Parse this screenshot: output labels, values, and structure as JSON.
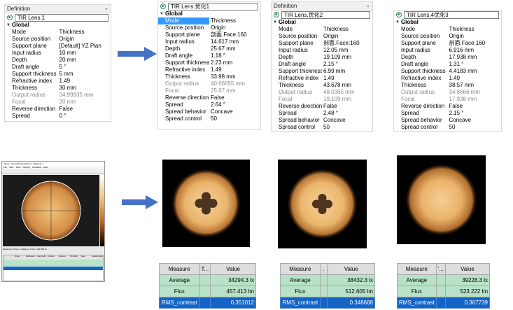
{
  "panels": [
    {
      "header": "Definition",
      "object": "TIR Lens.1",
      "section": "Global",
      "props": [
        {
          "k": "Mode",
          "v": "Thickness"
        },
        {
          "k": "Source position",
          "v": "Origin"
        },
        {
          "k": "Support plane",
          "v": "[Default] YZ Plan"
        },
        {
          "k": "Input radius",
          "v": "10 mm"
        },
        {
          "k": "Depth",
          "v": "20 mm"
        },
        {
          "k": "Draft angle",
          "v": "5 °"
        },
        {
          "k": "Support thickness",
          "v": "5 mm"
        },
        {
          "k": "Refractive index",
          "v": "1.49"
        },
        {
          "k": "Thickness",
          "v": "30 mm"
        },
        {
          "k": "Output radius",
          "v": "34.99935 mm",
          "grey": true
        },
        {
          "k": "Focal",
          "v": "20 mm",
          "grey": true
        },
        {
          "k": "Reverse direction",
          "v": "False"
        },
        {
          "k": "Spread",
          "v": "0 °"
        }
      ]
    },
    {
      "header": "",
      "object": "TIR Lens.优化1",
      "section": "Global",
      "props": [
        {
          "k": "Mode",
          "v": "Thickness",
          "sel": true
        },
        {
          "k": "Source position",
          "v": "Origin"
        },
        {
          "k": "Support plane",
          "v": "剖面.Face:160"
        },
        {
          "k": "Input radius",
          "v": "14.617 mm"
        },
        {
          "k": "Depth",
          "v": "25.67 mm"
        },
        {
          "k": "Draft angle",
          "v": "1.18 °"
        },
        {
          "k": "Support thickness",
          "v": "2.23 mm"
        },
        {
          "k": "Refractive index",
          "v": "1.49"
        },
        {
          "k": "Thickness",
          "v": "33.98 mm"
        },
        {
          "k": "Output radius",
          "v": "40.66655 mm",
          "grey": true
        },
        {
          "k": "Focal",
          "v": "25.67 mm",
          "grey": true
        },
        {
          "k": "Reverse direction",
          "v": "False"
        },
        {
          "k": "Spread",
          "v": "2.64 °"
        },
        {
          "k": "Spread behavior",
          "v": "Concave"
        },
        {
          "k": "Spread control",
          "v": "50"
        }
      ]
    },
    {
      "header": "Definition",
      "object": "TIR Lens.优化2",
      "section": "Global",
      "props": [
        {
          "k": "Mode",
          "v": "Thickness"
        },
        {
          "k": "Source position",
          "v": "Origin"
        },
        {
          "k": "Support plane",
          "v": "剖面.Face:160"
        },
        {
          "k": "Input radius",
          "v": "12.05 mm"
        },
        {
          "k": "Depth",
          "v": "19.109 mm"
        },
        {
          "k": "Draft angle",
          "v": "2.15 °"
        },
        {
          "k": "Support thickness",
          "v": "6.99 mm"
        },
        {
          "k": "Refractive index",
          "v": "1.49"
        },
        {
          "k": "Thickness",
          "v": "43.678 mm"
        },
        {
          "k": "Output radius",
          "v": "48.0365 mm",
          "grey": true
        },
        {
          "k": "Focal",
          "v": "19.109 mm",
          "grey": true
        },
        {
          "k": "Reverse direction",
          "v": "False"
        },
        {
          "k": "Spread",
          "v": "2.48 °"
        },
        {
          "k": "Spread behavior",
          "v": "Concave"
        },
        {
          "k": "Spread control",
          "v": "50"
        }
      ]
    },
    {
      "header": "",
      "object": "TIR Lens.4优化3",
      "section": "Global",
      "props": [
        {
          "k": "Mode",
          "v": "Thickness"
        },
        {
          "k": "Source position",
          "v": "Origin"
        },
        {
          "k": "Support plane",
          "v": "剖面.Face:160"
        },
        {
          "k": "Input radius",
          "v": "6.916 mm"
        },
        {
          "k": "Depth",
          "v": "17.938 mm"
        },
        {
          "k": "Draft angle",
          "v": "1.31 °"
        },
        {
          "k": "Support thickness",
          "v": "4.4183 mm"
        },
        {
          "k": "Refractive index",
          "v": "1.49"
        },
        {
          "k": "Thickness",
          "v": "38.57 mm"
        },
        {
          "k": "Output radius",
          "v": "34.8666 mm",
          "grey": true
        },
        {
          "k": "Focal",
          "v": "17.938 mm",
          "grey": true
        },
        {
          "k": "Reverse direction",
          "v": "False"
        },
        {
          "k": "Spread",
          "v": "2.15 °"
        },
        {
          "k": "Spread behavior",
          "v": "Concave"
        },
        {
          "k": "Spread control",
          "v": "50"
        }
      ]
    }
  ],
  "tables": [
    {
      "headers": [
        "Measure",
        "T...",
        "Value"
      ],
      "rows": [
        {
          "label": "Average",
          "value": "34294.3 lx"
        },
        {
          "label": "Flux",
          "value": "457.413 lm"
        },
        {
          "label": "RMS_contrast",
          "value": "0.351012",
          "hl": true
        }
      ]
    },
    {
      "headers": [
        "Measure",
        ".",
        "Value"
      ],
      "rows": [
        {
          "label": "Average",
          "value": "38432.3 lx"
        },
        {
          "label": "Flux",
          "value": "512.605 lm"
        },
        {
          "label": "RMS_contrast",
          "value": "0.348668",
          "hl": true
        }
      ]
    },
    {
      "headers": [
        "Measure",
        "'...",
        "Value"
      ],
      "rows": [
        {
          "label": "Average",
          "value": "39228.3 lx"
        },
        {
          "label": "Flux",
          "value": "523.222 lm"
        },
        {
          "label": "RMS_contrast",
          "value": "0.367739",
          "hl": true
        }
      ]
    }
  ],
  "app_window": {
    "title": "Speos - Spectral Map (Direct 1 radiance) *",
    "menu": [
      "File",
      "View",
      "Tools",
      "Filtering",
      "Operation",
      "Help"
    ],
    "measures_line": "Measures: Direct 1 radiance 1  Flux: 469.855 lm",
    "table_headers": [
      "",
      "Shape",
      "Parameters",
      "Integr.mode",
      "Contrast",
      "Measure",
      "Threshold",
      "Value",
      "Standard deviation"
    ]
  }
}
